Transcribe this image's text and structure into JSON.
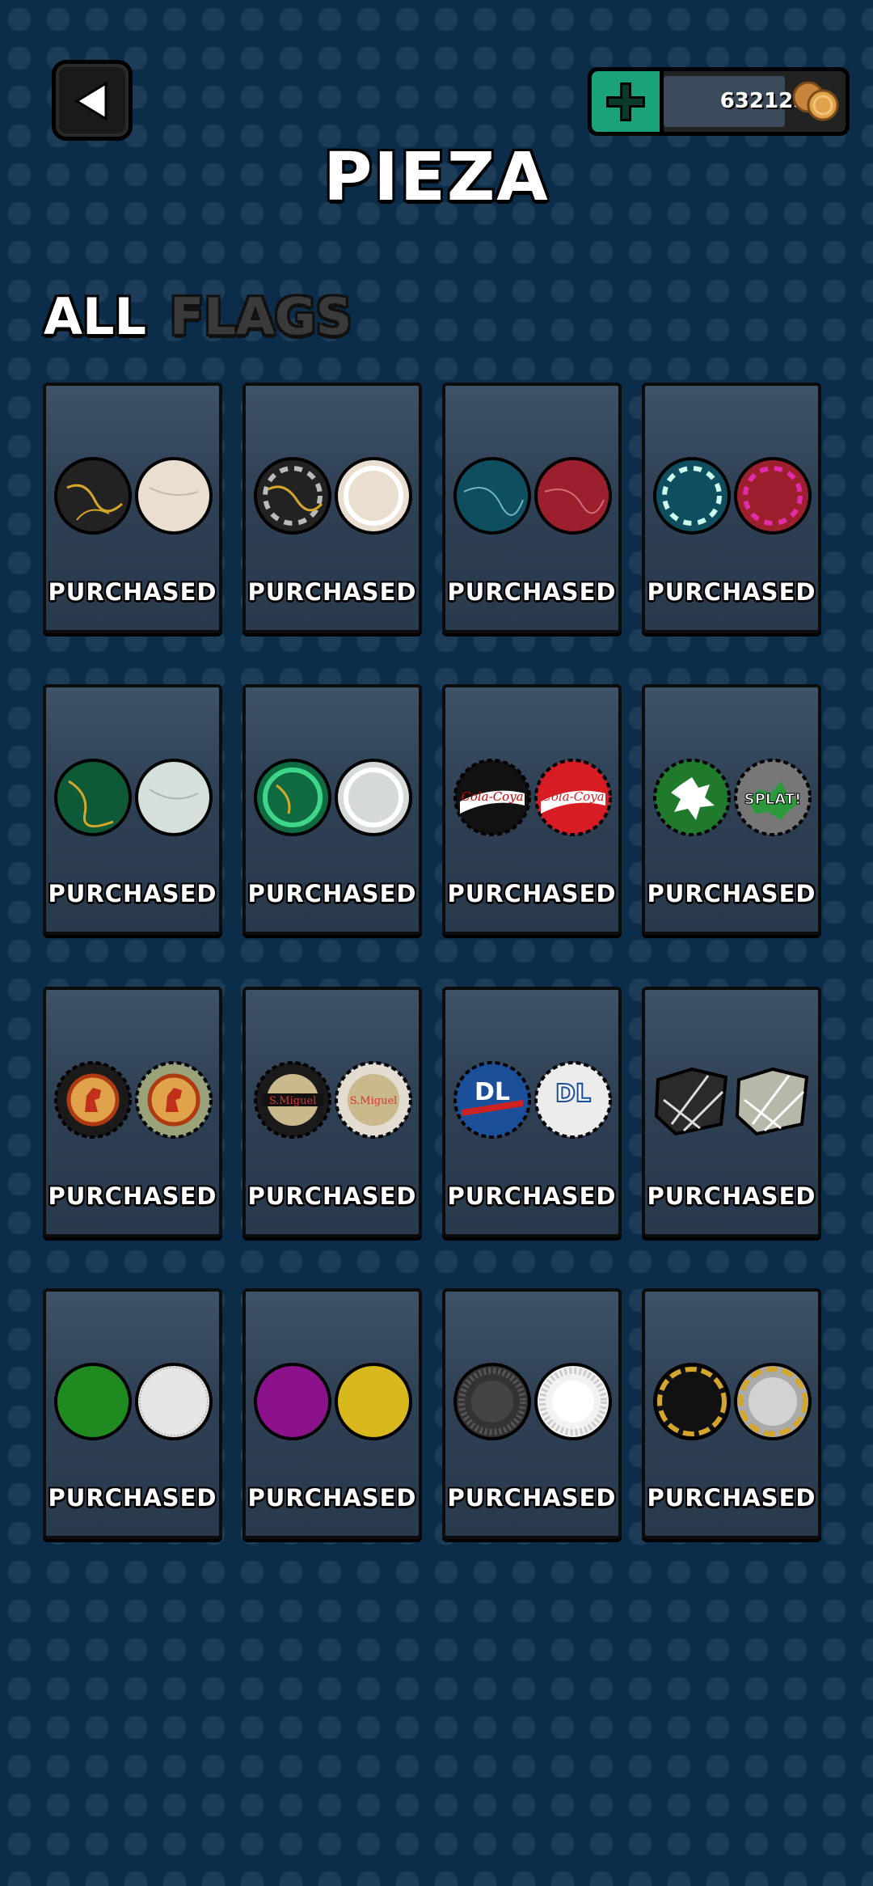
{
  "header": {
    "title": "PIEZA",
    "coins": "632125"
  },
  "tabs": [
    {
      "label": "ALL",
      "active": true
    },
    {
      "label": "FLAGS",
      "active": false
    }
  ],
  "status_label": "PURCHASED",
  "items": [
    {
      "name": "black-gold-marble",
      "status": "PURCHASED"
    },
    {
      "name": "black-gold-marble-chip",
      "status": "PURCHASED"
    },
    {
      "name": "teal-red-marble",
      "status": "PURCHASED"
    },
    {
      "name": "teal-red-marble-chip",
      "status": "PURCHASED"
    },
    {
      "name": "green-gold-marble",
      "status": "PURCHASED"
    },
    {
      "name": "green-gold-marble-chip",
      "status": "PURCHASED"
    },
    {
      "name": "cola-bottle-caps",
      "status": "PURCHASED"
    },
    {
      "name": "splat-caps",
      "status": "PURCHASED"
    },
    {
      "name": "horse-caps",
      "status": "PURCHASED"
    },
    {
      "name": "san-miguel-caps",
      "status": "PURCHASED"
    },
    {
      "name": "dl-caps",
      "status": "PURCHASED"
    },
    {
      "name": "stone-pieces",
      "status": "PURCHASED"
    },
    {
      "name": "green-white-plain",
      "status": "PURCHASED"
    },
    {
      "name": "purple-yellow-plain",
      "status": "PURCHASED"
    },
    {
      "name": "black-white-ridged",
      "status": "PURCHASED"
    },
    {
      "name": "black-silver-gold-rim",
      "status": "PURCHASED"
    }
  ],
  "cap_texts": {
    "cola": "Cola-Coya",
    "splat": "SPLAT!",
    "dl": "DL",
    "miguel": "S.Miguel"
  },
  "colors": {
    "background": "#0b2d4a",
    "plus_button": "#1aa37a",
    "coin": "#e0a24a"
  },
  "icons": {
    "back": "back-arrow-icon",
    "plus": "plus-icon",
    "coins": "coins-icon"
  }
}
